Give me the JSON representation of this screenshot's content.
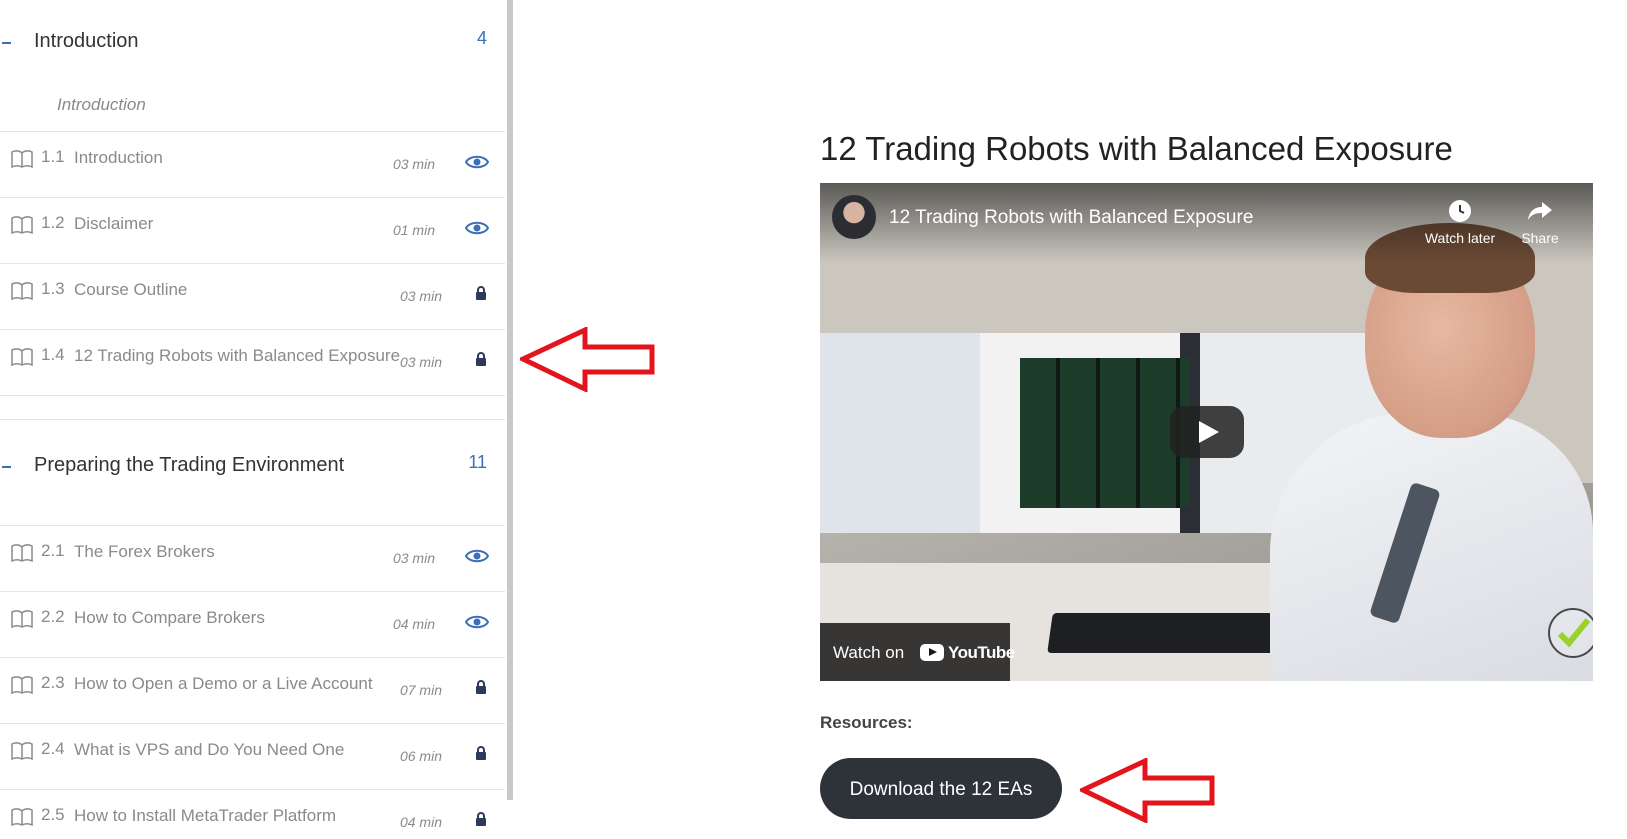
{
  "sidebar": {
    "sections": [
      {
        "title": "Introduction",
        "count": "4",
        "subtitle": "Introduction",
        "lessons": [
          {
            "num": "1.1",
            "title": "Introduction",
            "duration": "03 min",
            "access": "preview"
          },
          {
            "num": "1.2",
            "title": "Disclaimer",
            "duration": "01 min",
            "access": "preview"
          },
          {
            "num": "1.3",
            "title": "Course Outline",
            "duration": "03 min",
            "access": "locked"
          },
          {
            "num": "1.4",
            "title": "12 Trading Robots with Balanced Exposure",
            "duration": "03 min",
            "access": "locked"
          }
        ]
      },
      {
        "title": "Preparing the Trading Environment",
        "count": "11",
        "lessons": [
          {
            "num": "2.1",
            "title": "The Forex Brokers",
            "duration": "03 min",
            "access": "preview"
          },
          {
            "num": "2.2",
            "title": "How to Compare Brokers",
            "duration": "04 min",
            "access": "preview"
          },
          {
            "num": "2.3",
            "title": "How to Open a Demo or a Live Account",
            "duration": "07 min",
            "access": "locked"
          },
          {
            "num": "2.4",
            "title": "What is VPS and Do You Need One",
            "duration": "06 min",
            "access": "locked"
          },
          {
            "num": "2.5",
            "title": "How to Install MetaTrader Platform",
            "duration": "04 min",
            "access": "locked"
          }
        ]
      }
    ]
  },
  "main": {
    "title": "12 Trading Robots with Balanced Exposure",
    "video": {
      "title": "12 Trading Robots with Balanced Exposure",
      "watch_later": "Watch later",
      "share": "Share",
      "watch_on": "Watch on",
      "youtube": "YouTube"
    },
    "resources_label": "Resources:",
    "download_label": "Download the 12 EAs"
  },
  "colors": {
    "accent": "#3c6fb8",
    "lock": "#2e3a5c",
    "button_bg": "#2d3338",
    "annotation_arrow": "#e3141b"
  }
}
